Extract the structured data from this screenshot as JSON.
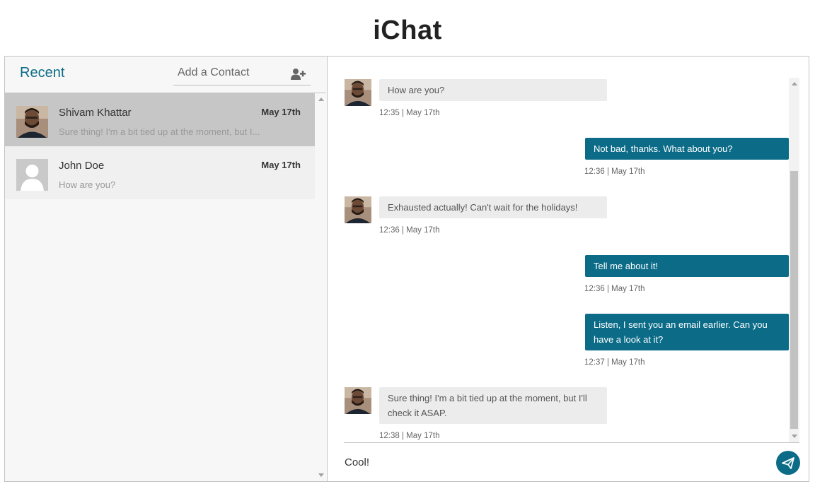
{
  "app": {
    "title": "iChat"
  },
  "sidebar": {
    "title": "Recent",
    "search_placeholder": "Add a Contact",
    "contacts": [
      {
        "name": "Shivam Khattar",
        "date": "May 17th",
        "preview": "Sure thing! I'm a bit tied up at the moment, but I...",
        "active": true,
        "avatar": "photo"
      },
      {
        "name": "John Doe",
        "date": "May 17th",
        "preview": "How are you?",
        "active": false,
        "avatar": "default-user-icon"
      }
    ]
  },
  "chat": {
    "messages": [
      {
        "direction": "in",
        "text": "How are you?",
        "meta": "12:35 | May 17th"
      },
      {
        "direction": "out",
        "text": "Not bad, thanks. What about you?",
        "meta": "12:36 | May 17th"
      },
      {
        "direction": "in",
        "text": "Exhausted actually! Can't wait for the holidays!",
        "meta": "12:36 | May 17th"
      },
      {
        "direction": "out",
        "text": "Tell me about it!",
        "meta": "12:36 | May 17th"
      },
      {
        "direction": "out",
        "text": "Listen, I sent you an email earlier. Can you have a look at it?",
        "meta": "12:37 | May 17th"
      },
      {
        "direction": "in",
        "text": "Sure thing! I'm a bit tied up at the moment, but I'll check it ASAP.",
        "meta": "12:38 | May 17th"
      }
    ],
    "input_value": "Cool!"
  },
  "colors": {
    "accent": "#0c6c88",
    "incoming_bubble": "#ececec",
    "active_contact": "#c6c6c6"
  }
}
